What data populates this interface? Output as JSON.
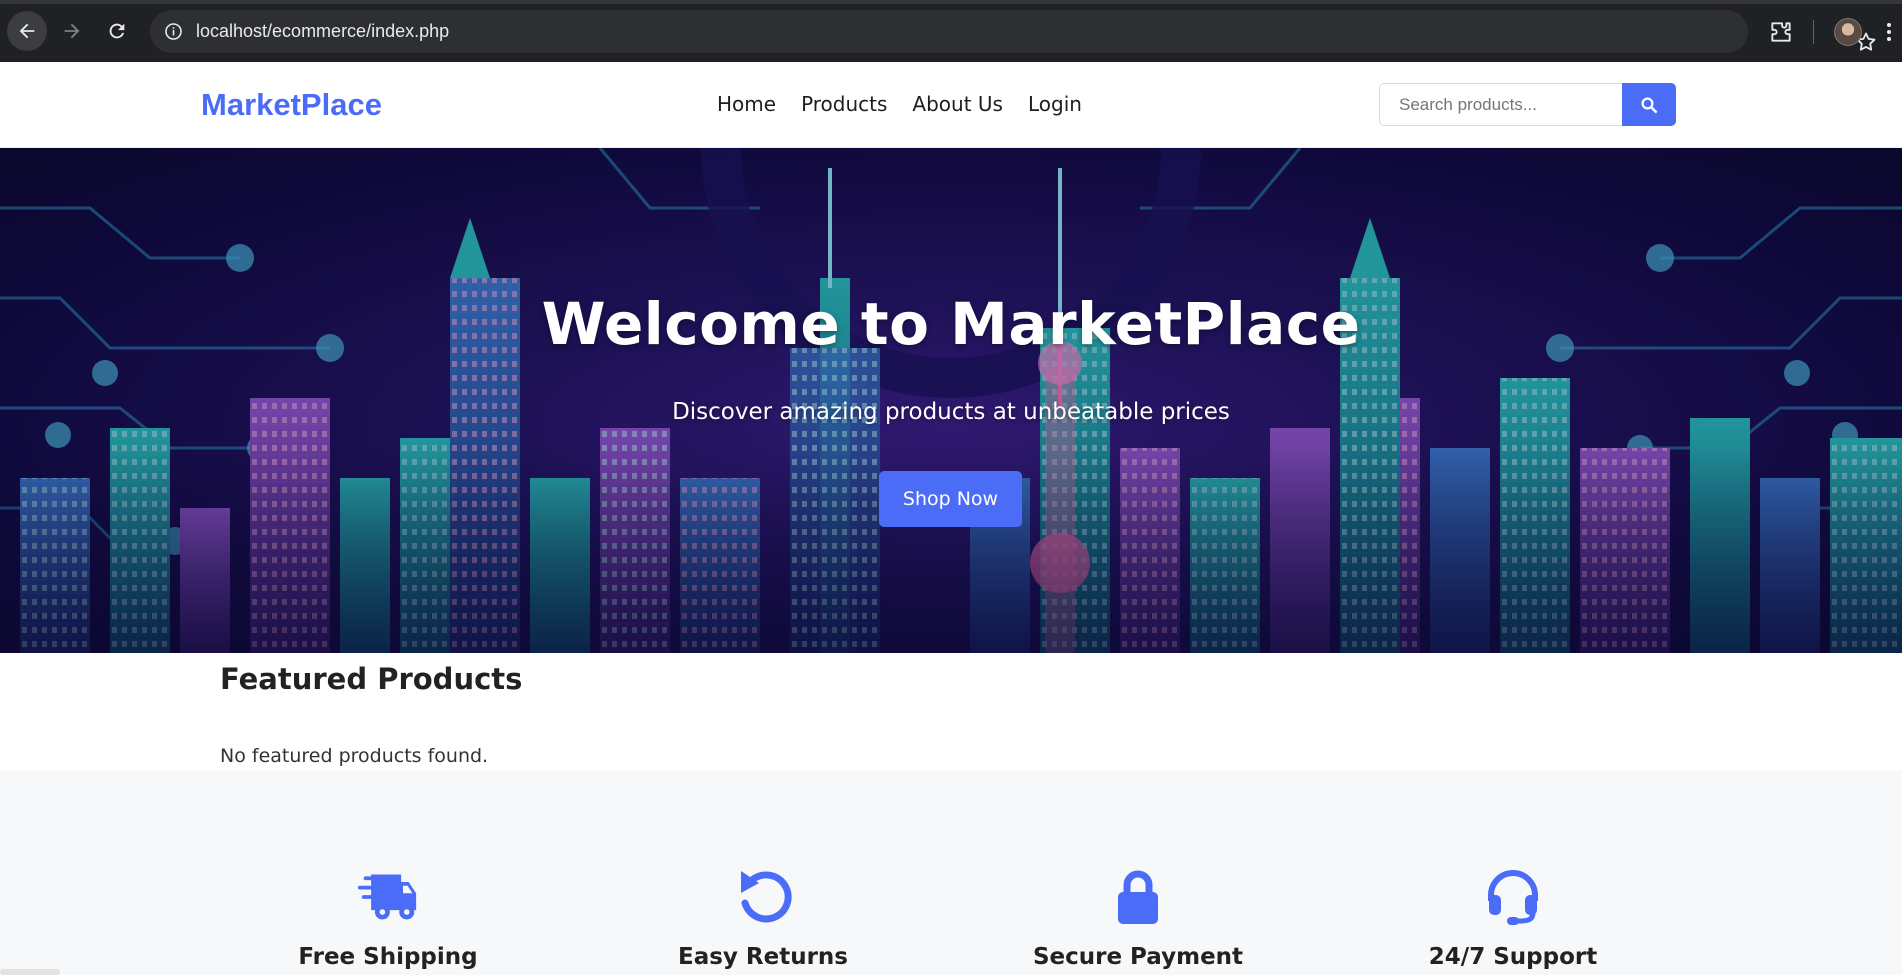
{
  "browser": {
    "url": "localhost/ecommerce/index.php",
    "icons": [
      "back-arrow-icon",
      "forward-arrow-icon",
      "reload-icon",
      "info-icon",
      "star-icon",
      "extensions-icon",
      "profile-avatar",
      "kebab-menu-icon"
    ]
  },
  "header": {
    "brand": "MarketPlace",
    "nav": [
      "Home",
      "Products",
      "About Us",
      "Login"
    ],
    "search_placeholder": "Search products...",
    "search_value": "",
    "search_icon": "search-icon"
  },
  "hero": {
    "title": "Welcome to MarketPlace",
    "subtitle": "Discover amazing products at unbeatable prices",
    "cta": "Shop Now"
  },
  "featured": {
    "title": "Featured Products",
    "empty_message": "No featured products found."
  },
  "features": [
    {
      "label": "Free Shipping",
      "icon": "truck-icon"
    },
    {
      "label": "Easy Returns",
      "icon": "undo-icon"
    },
    {
      "label": "Secure Payment",
      "icon": "lock-icon"
    },
    {
      "label": "24/7 Support",
      "icon": "headset-icon"
    }
  ],
  "colors": {
    "accent": "#4a6cf7",
    "browser_bg": "#202124",
    "features_bg": "#f7f8fa"
  }
}
